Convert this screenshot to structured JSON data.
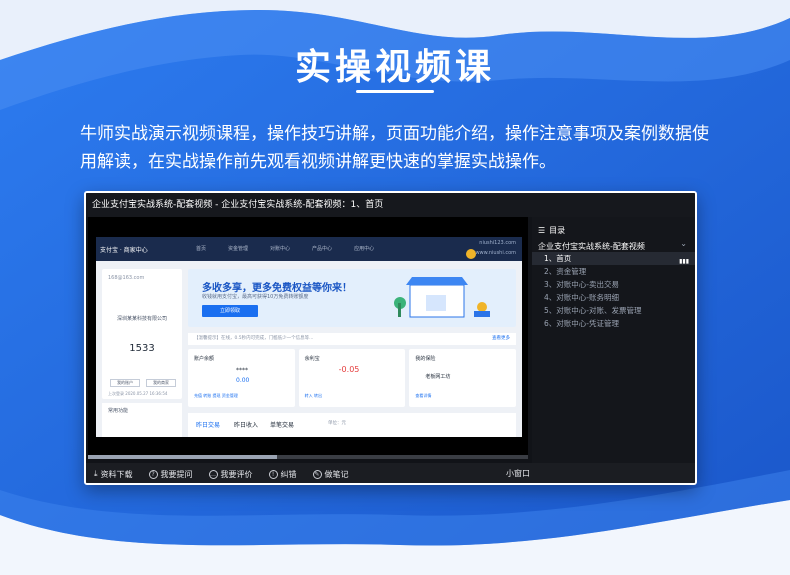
{
  "hero": {
    "title": "实操视频课",
    "description": "牛师实战演示视频课程，操作技巧讲解，页面功能介绍，操作注意事项及案例数据使用解读，在实战操作前先观看视频讲解更快速的掌握实战操作。"
  },
  "colors": {
    "background_blue": "#1f5fd6",
    "wave_white": "#f2f6fd",
    "player_dark": "#111318",
    "accent_blue": "#1a6ff0"
  },
  "player": {
    "window_title": "企业支付宝实战系统-配套视频 - 企业支付宝实战系统-配套视频：1、首页",
    "progress_fraction": 0.43,
    "screen": {
      "logo_text": "支付宝 · 商家中心",
      "nav": [
        "首页",
        "资金管理",
        "对账中心",
        "产品中心",
        "应用中心"
      ],
      "domain": "niushi123.com",
      "domain2": "www.niushi.com",
      "account_email": "168@163.com",
      "company": "深圳某某科技有限公司",
      "balance_number": "1533",
      "btn_one": "我的账户",
      "btn_two": "我的商家",
      "last_login": "上次登录 2020.05.27 16:36:54",
      "bottom_label": "常用功能",
      "banner_title": "多收多享，更多免费权益等你来！",
      "banner_sub": "收钱就用支付宝，最高可获得10万免费转账额度",
      "banner_button": "立即领取",
      "notice": "【温馨提示】在线，0.5秒内可完成，门槛低少一个信息等...",
      "notice_more": "查看更多",
      "card1_title": "账户余额",
      "card1_stars": "****",
      "card1_zero": "0.00",
      "card1_links": "充值 转账 提现   资金管理",
      "card2_title": "余利宝",
      "card2_value": "-0.05",
      "card2_links": "转入 转出",
      "card3_title": "我的保险",
      "card3_brand": "老板网工坊",
      "card3_links": "查看详情",
      "tab_a": "昨日交易",
      "tab_b": "昨日收入",
      "tab_c": "单笔交易",
      "tab_d": "单位：元"
    },
    "sidebar": {
      "header": "目录",
      "course": "企业支付宝实战系统-配套视频",
      "chevron": "⌄",
      "items": [
        "1、首页",
        "2、资金管理",
        "3、对账中心-卖出交易",
        "4、对账中心-账务明细",
        "5、对账中心-对账、发票管理",
        "6、对账中心-凭证管理"
      ],
      "active_index": 0
    },
    "toolbar": {
      "download": "资料下载",
      "question": "我要提问",
      "review": "我要评价",
      "correct": "纠错",
      "notes": "做笔记",
      "mini": "小窗口"
    }
  }
}
